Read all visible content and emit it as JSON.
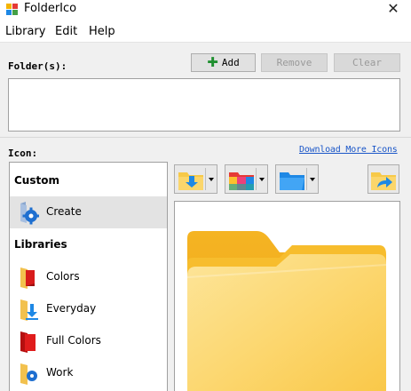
{
  "window": {
    "title": "FolderIco"
  },
  "menu": {
    "items": [
      "Library",
      "Edit",
      "Help"
    ]
  },
  "folders": {
    "label": "Folder(s):",
    "add": "Add",
    "remove": "Remove",
    "clear": "Clear"
  },
  "icon": {
    "label": "Icon:",
    "download_link": "Download More Icons"
  },
  "sidebar": {
    "custom_header": "Custom",
    "create_label": "Create",
    "libraries_header": "Libraries",
    "libraries": [
      "Colors",
      "Everyday",
      "Full Colors",
      "Work"
    ]
  },
  "colors": {
    "folder_yellow": "#f7c948",
    "folder_dark": "#f0b21d",
    "accent_blue": "#1e88e5",
    "link": "#1a56c8"
  }
}
